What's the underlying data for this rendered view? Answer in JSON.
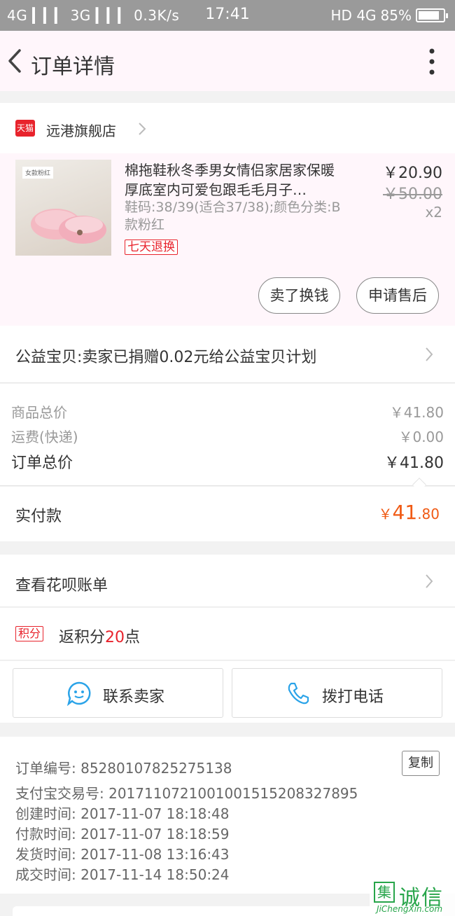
{
  "status_bar": {
    "left": "4G ▎▎▎ 3G ▎▎▎ 0.3K/s",
    "time": "17:41",
    "right_network": "HD 4G",
    "battery": "85%",
    "battery_level": 0.85
  },
  "nav": {
    "title": "订单详情",
    "back_icon": "chevron-left-icon",
    "more_icon": "more-vertical-icon"
  },
  "shop": {
    "badge": "天猫",
    "name": "远港旗舰店"
  },
  "item": {
    "thumb_tag": "女款粉红",
    "title": "棉拖鞋秋冬季男女情侣家居家保暖厚底室内可爱包跟毛毛月子…",
    "spec": "鞋码:38/39(适合37/38);颜色分类:B款粉红",
    "return_tag": "七天退换",
    "price": "￥20.90",
    "old_price": "￥50.00",
    "qty": "x2",
    "btn_sell": "卖了换钱",
    "btn_after": "申请售后"
  },
  "charity": {
    "text": "公益宝贝:卖家已捐赠0.02元给公益宝贝计划"
  },
  "summary": {
    "goods_label": "商品总价",
    "goods_value": "￥41.80",
    "shipping_label": "运费(快递)",
    "shipping_value": "￥0.00",
    "total_label": "订单总价",
    "total_value": "￥41.80"
  },
  "paid": {
    "label": "实付款",
    "symbol": "￥",
    "int": "41",
    "dec": ".80"
  },
  "huabei": {
    "text": "查看花呗账单"
  },
  "points": {
    "tag": "积分",
    "prefix": "返积分",
    "value": "20",
    "suffix": "点"
  },
  "contact": {
    "seller": "联系卖家",
    "phone": "拨打电话"
  },
  "info": {
    "order_no": "订单编号: 85280107825275138",
    "alipay_no": "支付宝交易号: 2017110721001001515208327895",
    "created": "创建时间: 2017-11-07 18:18:48",
    "paid_time": "付款时间: 2017-11-07 18:18:59",
    "shipped": "发货时间: 2017-11-08 13:16:43",
    "completed": "成交时间: 2017-11-14 18:50:24",
    "copy": "复制"
  },
  "watermark": {
    "logo": "集",
    "text": "诚信",
    "url": "JiChengXin.com"
  },
  "colors": {
    "accent": "#f05a14",
    "tmall_red": "#e8232c",
    "blue_icon": "#2aa3e8"
  }
}
